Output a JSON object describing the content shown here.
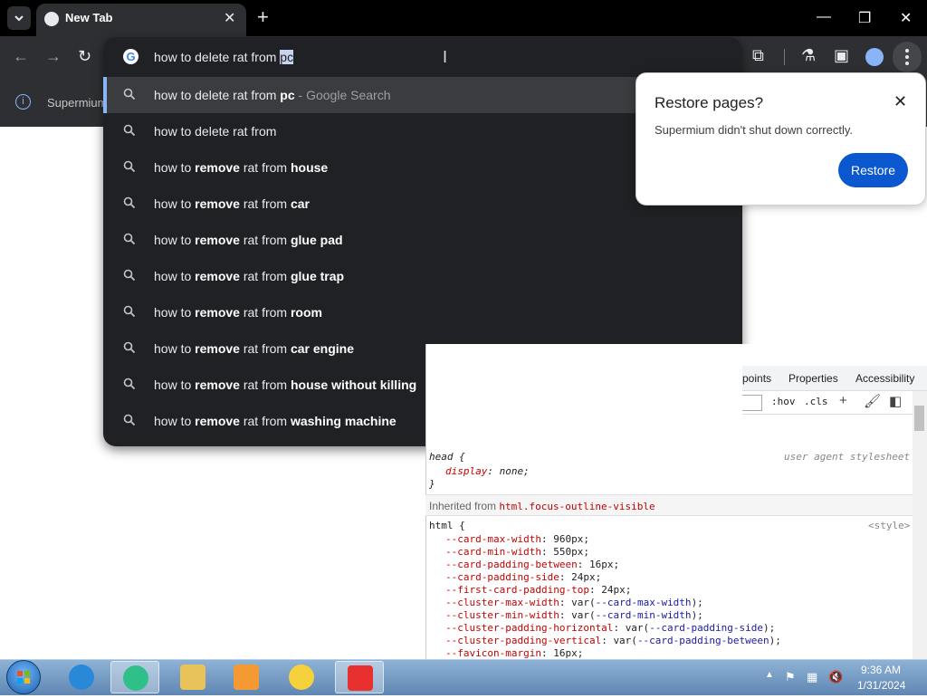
{
  "browser": {
    "tab_title": "New Tab",
    "bookmark_partial": "Supermium",
    "omnibox": {
      "typed_text": "how to delete rat from ",
      "selected_suffix": "pc"
    },
    "suggestions": [
      {
        "plain": "how to delete rat from ",
        "bold": "pc",
        "sub": " - Google Search",
        "selected": true
      },
      {
        "plain": "how to delete rat from",
        "bold": "",
        "sub": ""
      },
      {
        "plain": "how to ",
        "bold1": "remove",
        "mid": " rat from ",
        "bold": "house"
      },
      {
        "plain": "how to ",
        "bold1": "remove",
        "mid": " rat from ",
        "bold": "car"
      },
      {
        "plain": "how to ",
        "bold1": "remove",
        "mid": " rat from ",
        "bold": "glue pad"
      },
      {
        "plain": "how to ",
        "bold1": "remove",
        "mid": " rat from ",
        "bold": "glue trap"
      },
      {
        "plain": "how to ",
        "bold1": "remove",
        "mid": " rat from ",
        "bold": "room"
      },
      {
        "plain": "how to ",
        "bold1": "remove",
        "mid": " rat from ",
        "bold": "car engine"
      },
      {
        "plain": "how to ",
        "bold1": "remove",
        "mid": " rat from ",
        "bold": "house without killing"
      },
      {
        "plain": "how to ",
        "bold1": "remove",
        "mid": " rat from ",
        "bold": "washing machine"
      }
    ]
  },
  "restore_popup": {
    "title": "Restore pages?",
    "message": "Supermium didn't shut down correctly.",
    "button": "Restore"
  },
  "devtools": {
    "tabs": [
      "points",
      "Properties",
      "Accessibility"
    ],
    "filter_tools": [
      ":hov",
      ".cls"
    ],
    "head_rule": {
      "selector": "head {",
      "source": "user agent stylesheet",
      "prop": "display",
      "value": "none;",
      "close": "}"
    },
    "inherited_label": "Inherited from",
    "inherited_selector": "html.focus-outline-visible",
    "html_rule": {
      "selector": "html {",
      "source": "<style>"
    },
    "declarations": [
      {
        "prop": "--card-max-width",
        "value": "960px;"
      },
      {
        "prop": "--card-min-width",
        "value": "550px;"
      },
      {
        "prop": "--card-padding-between",
        "value": "16px;"
      },
      {
        "prop": "--card-padding-side",
        "value": "24px;"
      },
      {
        "prop": "--first-card-padding-top",
        "value": "24px;"
      },
      {
        "prop": "--cluster-max-width",
        "value": "var(",
        "var": "--card-max-width",
        "tail": ");"
      },
      {
        "prop": "--cluster-min-width",
        "value": "var(",
        "var": "--card-min-width",
        "tail": ");"
      },
      {
        "prop": "--cluster-padding-horizontal",
        "value": "var(",
        "var": "--card-padding-side",
        "tail": ");"
      },
      {
        "prop": "--cluster-padding-vertical",
        "value": "var(",
        "var": "--card-padding-between",
        "tail": ");"
      },
      {
        "prop": "--favicon-margin",
        "value": "16px;"
      }
    ]
  },
  "taskbar": {
    "time": "9:36 AM",
    "date": "1/31/2024"
  },
  "colors": {
    "omnibox_bg": "#202124",
    "accent_blue": "#0b57d0",
    "selection_bar": "#8ab4f8"
  }
}
